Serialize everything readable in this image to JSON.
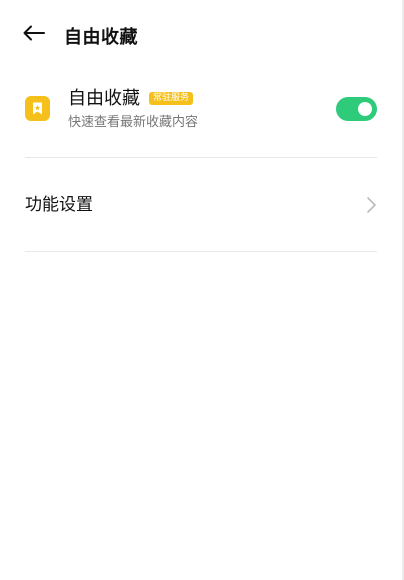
{
  "header": {
    "back_icon": "arrow-left-icon",
    "title": "自由收藏"
  },
  "feature": {
    "icon": "bookmark-app-icon",
    "title": "自由收藏",
    "badge": "常驻服务",
    "subtitle": "快速查看最新收藏内容",
    "toggle_on": true
  },
  "settings": {
    "label": "功能设置",
    "chevron_icon": "chevron-right-icon"
  },
  "colors": {
    "accent_toggle": "#2ecb7a",
    "app_icon": "#f6c01c",
    "badge": "#f6c01c"
  }
}
